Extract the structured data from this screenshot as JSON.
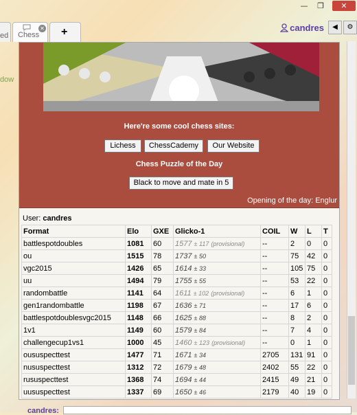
{
  "window": {
    "minimize": "—",
    "restore": "❐",
    "close": "✕"
  },
  "tabs": [
    {
      "label": "ed"
    },
    {
      "label": "Chess"
    },
    {
      "label": "+"
    }
  ],
  "left_peek_text": "dow",
  "user": {
    "name": "candres"
  },
  "promo": {
    "heading": "Here're some cool chess sites:",
    "sites": [
      "Lichess",
      "ChessCademy",
      "Our Website"
    ],
    "puzzle_heading": "Chess Puzzle of the Day",
    "puzzle_button": "Black to move and mate in 5",
    "opening": "Opening of the day: Englur"
  },
  "ratings": {
    "user_label": "User:",
    "user_name": "candres",
    "headers": [
      "Format",
      "Elo",
      "GXE",
      "Glicko-1",
      "COIL",
      "W",
      "L",
      "T"
    ],
    "rows": [
      {
        "format": "battlespotdoubles",
        "elo": "1081",
        "gxe": "60",
        "glicko": "1577",
        "dev": "± 117",
        "prov": "(provisional)",
        "coil": "--",
        "w": "2",
        "l": "0",
        "t": "0"
      },
      {
        "format": "ou",
        "elo": "1515",
        "gxe": "78",
        "glicko": "1737",
        "dev": "± 50",
        "prov": "",
        "coil": "--",
        "w": "75",
        "l": "42",
        "t": "0"
      },
      {
        "format": "vgc2015",
        "elo": "1426",
        "gxe": "65",
        "glicko": "1614",
        "dev": "± 33",
        "prov": "",
        "coil": "--",
        "w": "105",
        "l": "75",
        "t": "0"
      },
      {
        "format": "uu",
        "elo": "1494",
        "gxe": "79",
        "glicko": "1755",
        "dev": "± 55",
        "prov": "",
        "coil": "--",
        "w": "53",
        "l": "22",
        "t": "0"
      },
      {
        "format": "randombattle",
        "elo": "1141",
        "gxe": "64",
        "glicko": "1611",
        "dev": "± 102",
        "prov": "(provisional)",
        "coil": "--",
        "w": "6",
        "l": "1",
        "t": "0"
      },
      {
        "format": "gen1randombattle",
        "elo": "1198",
        "gxe": "67",
        "glicko": "1636",
        "dev": "± 71",
        "prov": "",
        "coil": "--",
        "w": "17",
        "l": "6",
        "t": "0"
      },
      {
        "format": "battlespotdoublesvgc2015",
        "elo": "1148",
        "gxe": "66",
        "glicko": "1625",
        "dev": "± 88",
        "prov": "",
        "coil": "--",
        "w": "8",
        "l": "2",
        "t": "0"
      },
      {
        "format": "1v1",
        "elo": "1149",
        "gxe": "60",
        "glicko": "1579",
        "dev": "± 84",
        "prov": "",
        "coil": "--",
        "w": "7",
        "l": "4",
        "t": "0"
      },
      {
        "format": "challengecup1vs1",
        "elo": "1000",
        "gxe": "45",
        "glicko": "1460",
        "dev": "± 123",
        "prov": "(provisional)",
        "coil": "--",
        "w": "0",
        "l": "1",
        "t": "0"
      },
      {
        "format": "oususpecttest",
        "elo": "1477",
        "gxe": "71",
        "glicko": "1671",
        "dev": "± 34",
        "prov": "",
        "coil": "2705",
        "w": "131",
        "l": "91",
        "t": "0"
      },
      {
        "format": "nususpecttest",
        "elo": "1312",
        "gxe": "72",
        "glicko": "1679",
        "dev": "± 48",
        "prov": "",
        "coil": "2402",
        "w": "55",
        "l": "22",
        "t": "0"
      },
      {
        "format": "rususpecttest",
        "elo": "1368",
        "gxe": "74",
        "glicko": "1694",
        "dev": "± 44",
        "prov": "",
        "coil": "2415",
        "w": "49",
        "l": "21",
        "t": "0"
      },
      {
        "format": "uususpecttest",
        "elo": "1337",
        "gxe": "69",
        "glicko": "1650",
        "dev": "± 46",
        "prov": "",
        "coil": "2179",
        "w": "40",
        "l": "19",
        "t": "0"
      }
    ]
  },
  "chat": {
    "name": "candres:"
  },
  "icons": {
    "user": "user-icon",
    "mute": "volume-icon",
    "settings": "gear-icon"
  }
}
